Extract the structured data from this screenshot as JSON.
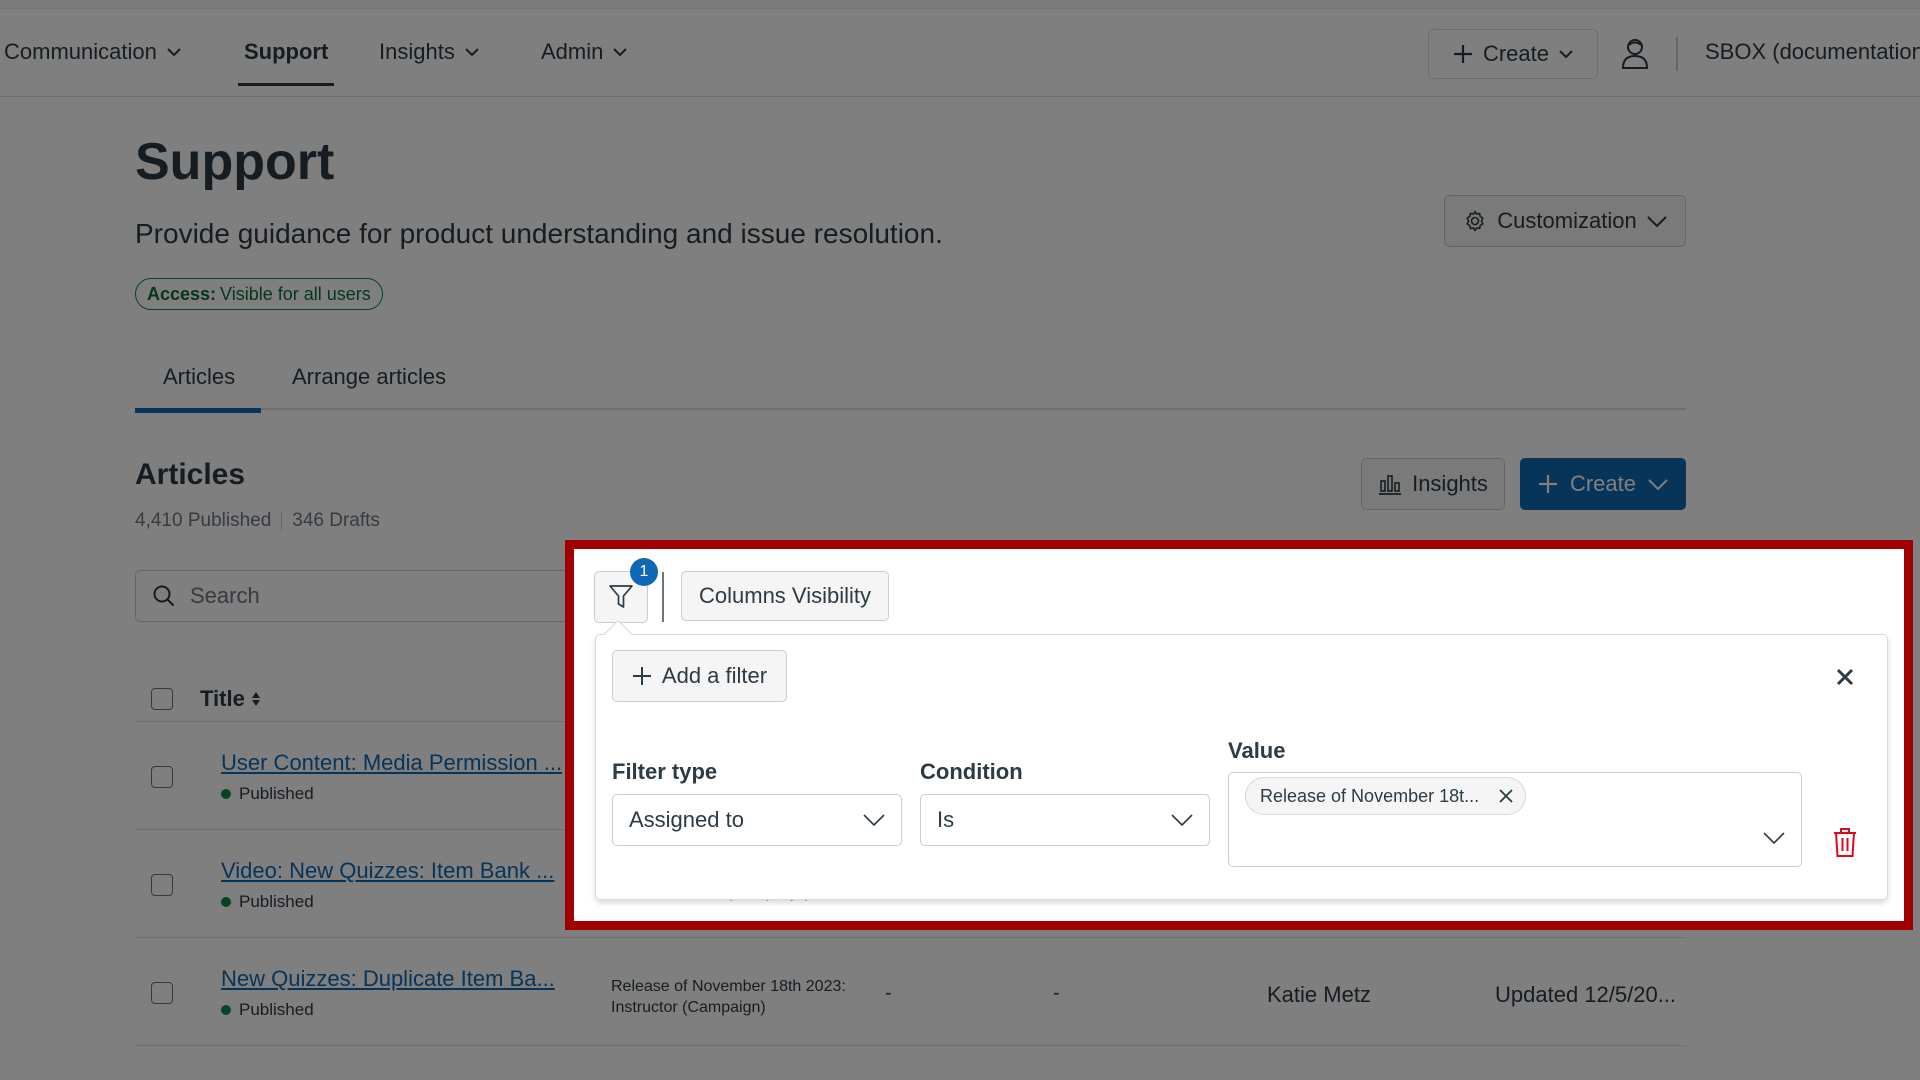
{
  "topnav": {
    "items": [
      {
        "label": "Communication",
        "has_dropdown": true,
        "active": false
      },
      {
        "label": "Support",
        "has_dropdown": false,
        "active": true
      },
      {
        "label": "Insights",
        "has_dropdown": true,
        "active": false
      },
      {
        "label": "Admin",
        "has_dropdown": true,
        "active": false
      }
    ],
    "create_label": "Create",
    "org_name": "SBOX (documentation"
  },
  "page": {
    "title": "Support",
    "subtitle": "Provide guidance for product understanding and issue resolution.",
    "access_label": "Access:",
    "access_value": "Visible for all users",
    "customization_label": "Customization"
  },
  "tabs": [
    {
      "label": "Articles",
      "active": true
    },
    {
      "label": "Arrange articles",
      "active": false
    }
  ],
  "articles": {
    "title": "Articles",
    "published_count": "4,410 Published",
    "drafts_count": "346 Drafts",
    "insights_label": "Insights",
    "create_label": "Create",
    "search_placeholder": "Search",
    "columns_visibility_label": "Columns Visibility",
    "filter_count": "1",
    "table": {
      "title_header": "Title",
      "rows": [
        {
          "title": "User Content: Media Permission ...",
          "status": "Published",
          "assigned": "",
          "col3": "",
          "col4": "",
          "author": "",
          "updated": ""
        },
        {
          "title": "Video: New Quizzes: Item Bank ...",
          "status": "Published",
          "assigned": "2023: Instructor (Campaign)",
          "col3": "",
          "col4": "",
          "author": "",
          "updated": ""
        },
        {
          "title": "New Quizzes: Duplicate Item Ba...",
          "status": "Published",
          "assigned": "Release of November 18th 2023: Instructor (Campaign)",
          "col3": "-",
          "col4": "-",
          "author": "Katie Metz",
          "updated": "Updated 12/5/20..."
        }
      ]
    }
  },
  "filter_panel": {
    "add_filter_label": "Add a filter",
    "filter_type_label": "Filter type",
    "filter_type_value": "Assigned to",
    "condition_label": "Condition",
    "condition_value": "Is",
    "value_label": "Value",
    "value_chip": "Release of November 18t..."
  },
  "colors": {
    "primary": "#0e68b3",
    "success": "#0b874b",
    "danger": "#e0061f",
    "highlight_frame": "#a00000"
  }
}
